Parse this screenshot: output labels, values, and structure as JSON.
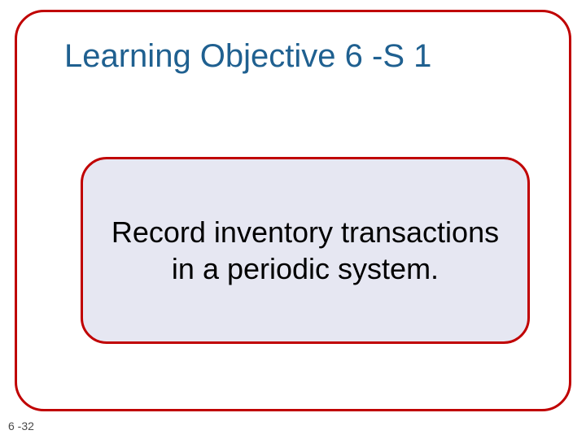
{
  "slide": {
    "title": "Learning Objective 6 -S 1",
    "body": "Record inventory transactions in a periodic system.",
    "page_number": "6 -32"
  },
  "colors": {
    "border": "#c00000",
    "title_text": "#1f6090",
    "inner_bg": "#e6e7f2"
  }
}
